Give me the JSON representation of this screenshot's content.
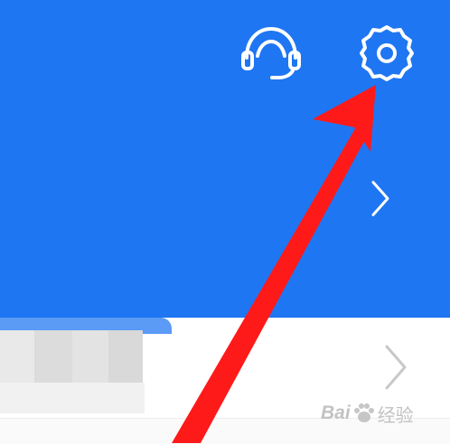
{
  "header": {
    "background_color": "#1f76f2",
    "icons": [
      "customer-service-icon",
      "gear-icon",
      "chevron-right-icon"
    ]
  },
  "card": {
    "tab_color": "#5b9af5",
    "chevron_icon": "chevron-right-icon"
  },
  "watermark": {
    "brand": "Bai",
    "brand_suffix": "经验",
    "icon": "paw-icon"
  },
  "annotation": {
    "arrow_color": "#ff1a1a",
    "points_to": "gear-icon"
  }
}
